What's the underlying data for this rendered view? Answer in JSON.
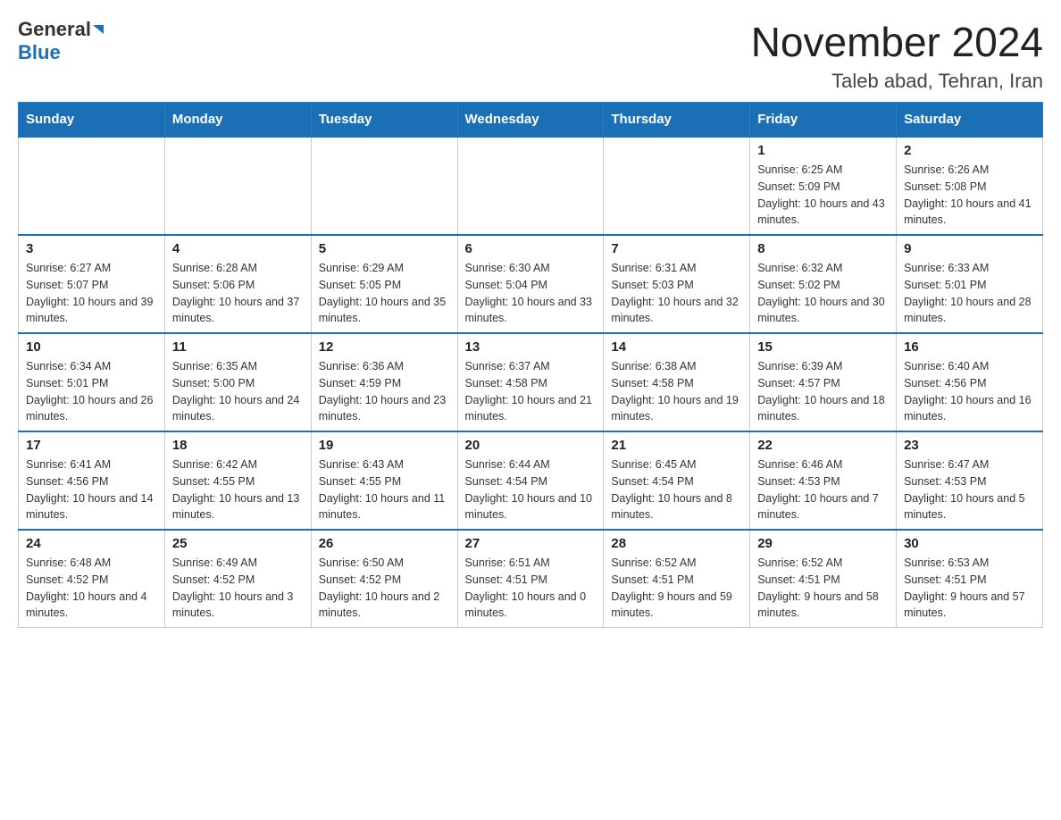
{
  "header": {
    "logo_general": "General",
    "logo_blue": "Blue",
    "month_year": "November 2024",
    "location": "Taleb abad, Tehran, Iran"
  },
  "days_of_week": [
    "Sunday",
    "Monday",
    "Tuesday",
    "Wednesday",
    "Thursday",
    "Friday",
    "Saturday"
  ],
  "weeks": [
    [
      {
        "day": "",
        "info": ""
      },
      {
        "day": "",
        "info": ""
      },
      {
        "day": "",
        "info": ""
      },
      {
        "day": "",
        "info": ""
      },
      {
        "day": "",
        "info": ""
      },
      {
        "day": "1",
        "info": "Sunrise: 6:25 AM\nSunset: 5:09 PM\nDaylight: 10 hours and 43 minutes."
      },
      {
        "day": "2",
        "info": "Sunrise: 6:26 AM\nSunset: 5:08 PM\nDaylight: 10 hours and 41 minutes."
      }
    ],
    [
      {
        "day": "3",
        "info": "Sunrise: 6:27 AM\nSunset: 5:07 PM\nDaylight: 10 hours and 39 minutes."
      },
      {
        "day": "4",
        "info": "Sunrise: 6:28 AM\nSunset: 5:06 PM\nDaylight: 10 hours and 37 minutes."
      },
      {
        "day": "5",
        "info": "Sunrise: 6:29 AM\nSunset: 5:05 PM\nDaylight: 10 hours and 35 minutes."
      },
      {
        "day": "6",
        "info": "Sunrise: 6:30 AM\nSunset: 5:04 PM\nDaylight: 10 hours and 33 minutes."
      },
      {
        "day": "7",
        "info": "Sunrise: 6:31 AM\nSunset: 5:03 PM\nDaylight: 10 hours and 32 minutes."
      },
      {
        "day": "8",
        "info": "Sunrise: 6:32 AM\nSunset: 5:02 PM\nDaylight: 10 hours and 30 minutes."
      },
      {
        "day": "9",
        "info": "Sunrise: 6:33 AM\nSunset: 5:01 PM\nDaylight: 10 hours and 28 minutes."
      }
    ],
    [
      {
        "day": "10",
        "info": "Sunrise: 6:34 AM\nSunset: 5:01 PM\nDaylight: 10 hours and 26 minutes."
      },
      {
        "day": "11",
        "info": "Sunrise: 6:35 AM\nSunset: 5:00 PM\nDaylight: 10 hours and 24 minutes."
      },
      {
        "day": "12",
        "info": "Sunrise: 6:36 AM\nSunset: 4:59 PM\nDaylight: 10 hours and 23 minutes."
      },
      {
        "day": "13",
        "info": "Sunrise: 6:37 AM\nSunset: 4:58 PM\nDaylight: 10 hours and 21 minutes."
      },
      {
        "day": "14",
        "info": "Sunrise: 6:38 AM\nSunset: 4:58 PM\nDaylight: 10 hours and 19 minutes."
      },
      {
        "day": "15",
        "info": "Sunrise: 6:39 AM\nSunset: 4:57 PM\nDaylight: 10 hours and 18 minutes."
      },
      {
        "day": "16",
        "info": "Sunrise: 6:40 AM\nSunset: 4:56 PM\nDaylight: 10 hours and 16 minutes."
      }
    ],
    [
      {
        "day": "17",
        "info": "Sunrise: 6:41 AM\nSunset: 4:56 PM\nDaylight: 10 hours and 14 minutes."
      },
      {
        "day": "18",
        "info": "Sunrise: 6:42 AM\nSunset: 4:55 PM\nDaylight: 10 hours and 13 minutes."
      },
      {
        "day": "19",
        "info": "Sunrise: 6:43 AM\nSunset: 4:55 PM\nDaylight: 10 hours and 11 minutes."
      },
      {
        "day": "20",
        "info": "Sunrise: 6:44 AM\nSunset: 4:54 PM\nDaylight: 10 hours and 10 minutes."
      },
      {
        "day": "21",
        "info": "Sunrise: 6:45 AM\nSunset: 4:54 PM\nDaylight: 10 hours and 8 minutes."
      },
      {
        "day": "22",
        "info": "Sunrise: 6:46 AM\nSunset: 4:53 PM\nDaylight: 10 hours and 7 minutes."
      },
      {
        "day": "23",
        "info": "Sunrise: 6:47 AM\nSunset: 4:53 PM\nDaylight: 10 hours and 5 minutes."
      }
    ],
    [
      {
        "day": "24",
        "info": "Sunrise: 6:48 AM\nSunset: 4:52 PM\nDaylight: 10 hours and 4 minutes."
      },
      {
        "day": "25",
        "info": "Sunrise: 6:49 AM\nSunset: 4:52 PM\nDaylight: 10 hours and 3 minutes."
      },
      {
        "day": "26",
        "info": "Sunrise: 6:50 AM\nSunset: 4:52 PM\nDaylight: 10 hours and 2 minutes."
      },
      {
        "day": "27",
        "info": "Sunrise: 6:51 AM\nSunset: 4:51 PM\nDaylight: 10 hours and 0 minutes."
      },
      {
        "day": "28",
        "info": "Sunrise: 6:52 AM\nSunset: 4:51 PM\nDaylight: 9 hours and 59 minutes."
      },
      {
        "day": "29",
        "info": "Sunrise: 6:52 AM\nSunset: 4:51 PM\nDaylight: 9 hours and 58 minutes."
      },
      {
        "day": "30",
        "info": "Sunrise: 6:53 AM\nSunset: 4:51 PM\nDaylight: 9 hours and 57 minutes."
      }
    ]
  ]
}
